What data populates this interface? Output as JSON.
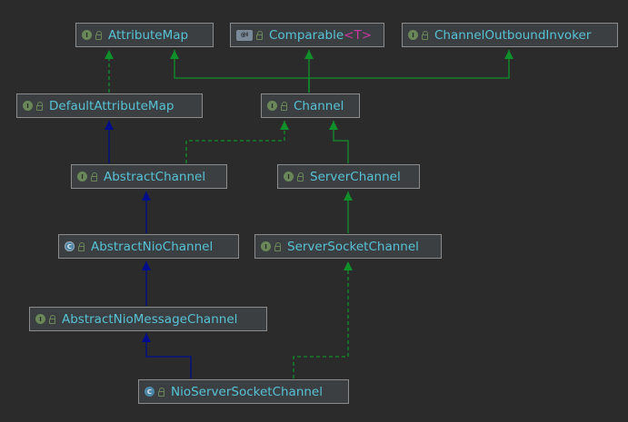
{
  "diagram": {
    "colors": {
      "background": "#2b2b2b",
      "node_fill": "#3c3f41",
      "node_border": "#8c8c8c",
      "label": "#56c2d6",
      "type_param": "#c837a5",
      "extends_edge": "#000d8c",
      "implements_edge": "#118f2a",
      "interface_realization_edge": "#118f2a"
    },
    "nodes": [
      {
        "id": "attributemap",
        "label": "AttributeMap",
        "kind": "interface",
        "icon": "I"
      },
      {
        "id": "comparable",
        "label": "Comparable",
        "type_param": "<T>",
        "kind": "interface-generic",
        "icon": "@I"
      },
      {
        "id": "channeloutboundinvoker",
        "label": "ChannelOutboundInvoker",
        "kind": "interface",
        "icon": "I"
      },
      {
        "id": "defaultattributemap",
        "label": "DefaultAttributeMap",
        "kind": "interface",
        "icon": "I"
      },
      {
        "id": "channel",
        "label": "Channel",
        "kind": "interface",
        "icon": "I"
      },
      {
        "id": "abstractchannel",
        "label": "AbstractChannel",
        "kind": "interface",
        "icon": "I"
      },
      {
        "id": "serverchannel",
        "label": "ServerChannel",
        "kind": "interface",
        "icon": "I"
      },
      {
        "id": "abstractniochannel",
        "label": "AbstractNioChannel",
        "kind": "abstract-class",
        "icon": "C"
      },
      {
        "id": "serversocketchannel",
        "label": "ServerSocketChannel",
        "kind": "interface",
        "icon": "I"
      },
      {
        "id": "abstractniomessagechannel",
        "label": "AbstractNioMessageChannel",
        "kind": "interface",
        "icon": "I"
      },
      {
        "id": "nioserversocketchannel",
        "label": "NioServerSocketChannel",
        "kind": "class",
        "icon": "C"
      }
    ],
    "edges": [
      {
        "from": "defaultattributemap",
        "to": "attributemap",
        "style": "dashed"
      },
      {
        "from": "channel",
        "to": "attributemap",
        "style": "solid"
      },
      {
        "from": "channel",
        "to": "comparable",
        "style": "solid"
      },
      {
        "from": "channel",
        "to": "channeloutboundinvoker",
        "style": "solid"
      },
      {
        "from": "abstractchannel",
        "to": "defaultattributemap",
        "style": "solid"
      },
      {
        "from": "abstractchannel",
        "to": "channel",
        "style": "dashed"
      },
      {
        "from": "serverchannel",
        "to": "channel",
        "style": "solid"
      },
      {
        "from": "abstractniochannel",
        "to": "abstractchannel",
        "style": "solid"
      },
      {
        "from": "serversocketchannel",
        "to": "serverchannel",
        "style": "solid"
      },
      {
        "from": "abstractniomessagechannel",
        "to": "abstractniochannel",
        "style": "solid"
      },
      {
        "from": "nioserversocketchannel",
        "to": "abstractniomessagechannel",
        "style": "solid"
      },
      {
        "from": "nioserversocketchannel",
        "to": "serversocketchannel",
        "style": "dashed"
      }
    ]
  }
}
